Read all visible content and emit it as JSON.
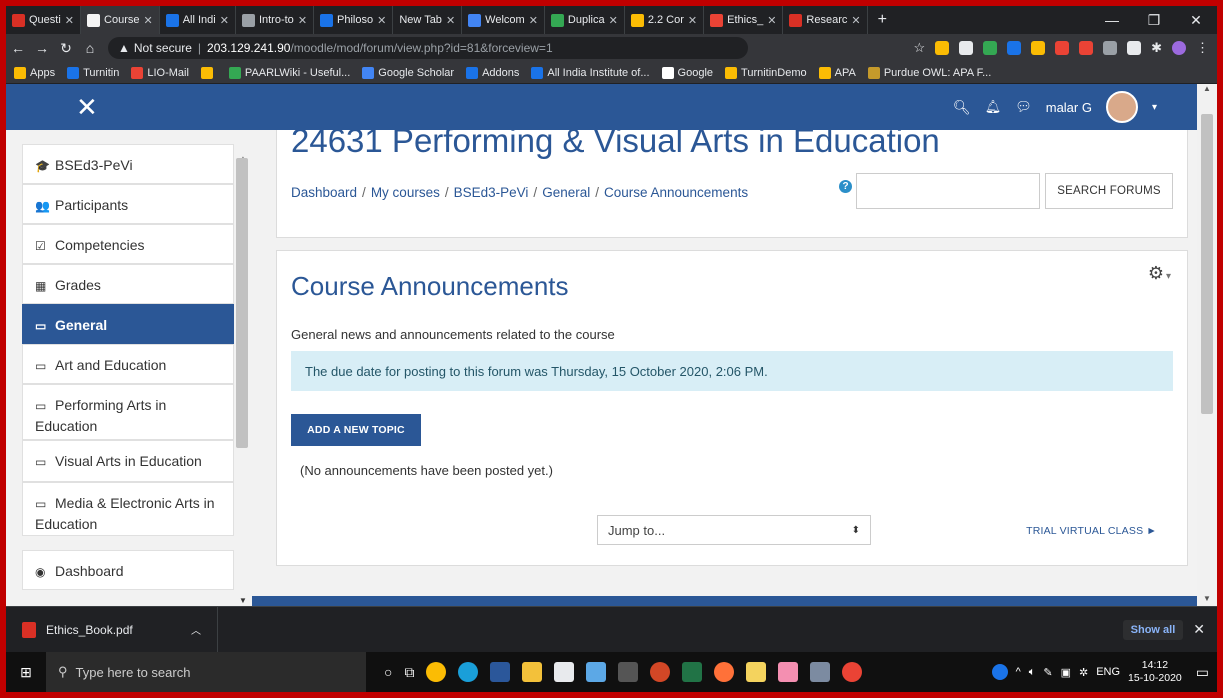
{
  "browser": {
    "tabs": [
      {
        "label": "Questi",
        "color": "#d93025",
        "active": false
      },
      {
        "label": "Course",
        "color": "#f4f4f4",
        "active": true
      },
      {
        "label": "All Indi",
        "color": "#1a73e8",
        "active": false
      },
      {
        "label": "Intro-to",
        "color": "#9aa0a6",
        "active": false
      },
      {
        "label": "Philoso",
        "color": "#1a73e8",
        "active": false
      },
      {
        "label": "New Tab",
        "color": "",
        "active": false
      },
      {
        "label": "Welcom",
        "color": "#4285f4",
        "active": false
      },
      {
        "label": "Duplica",
        "color": "#34a853",
        "active": false
      },
      {
        "label": "2.2 Cor",
        "color": "#fbbc04",
        "active": false
      },
      {
        "label": "Ethics_",
        "color": "#ea4335",
        "active": false
      },
      {
        "label": "Researc",
        "color": "#d93025",
        "active": false
      }
    ],
    "url_warning": "Not secure",
    "url_host": "203.129.241.90",
    "url_path": "/moodle/mod/forum/view.php?id=81&forceview=1",
    "bookmarks": [
      {
        "label": "Apps",
        "color": "#fbbc04"
      },
      {
        "label": "Turnitin",
        "color": "#1a73e8"
      },
      {
        "label": "LIO-Mail",
        "color": "#ea4335"
      },
      {
        "label": "",
        "color": "#fbbc04"
      },
      {
        "label": "PAARLWiki - Useful...",
        "color": "#34a853"
      },
      {
        "label": "Google Scholar",
        "color": "#4285f4"
      },
      {
        "label": "Addons",
        "color": "#1a73e8"
      },
      {
        "label": "All India Institute of...",
        "color": "#1a73e8"
      },
      {
        "label": "Google",
        "color": "#ffffff"
      },
      {
        "label": "TurnitinDemo",
        "color": "#fbbc04"
      },
      {
        "label": "APA",
        "color": "#fbbc04"
      },
      {
        "label": "Purdue OWL: APA F...",
        "color": "#c59a2b"
      }
    ]
  },
  "navbar": {
    "user_name": "malar G",
    "brand_color": "#2b5796"
  },
  "drawer": {
    "items": [
      {
        "label": "BSEd3-PeVi",
        "icon": "graduation-cap-icon",
        "glyph": "🎓",
        "active": false
      },
      {
        "label": "Participants",
        "icon": "users-icon",
        "glyph": "👥",
        "active": false
      },
      {
        "label": "Competencies",
        "icon": "checkbox-icon",
        "glyph": "☑",
        "active": false
      },
      {
        "label": "Grades",
        "icon": "table-icon",
        "glyph": "▦",
        "active": false
      },
      {
        "label": "General",
        "icon": "folder-icon",
        "glyph": "▭",
        "active": true
      },
      {
        "label": "Art and Education",
        "icon": "folder-icon",
        "glyph": "▭",
        "active": false
      },
      {
        "label": "Performing Arts in Education",
        "icon": "folder-icon",
        "glyph": "▭",
        "active": false
      },
      {
        "label": "Visual Arts in Education",
        "icon": "folder-icon",
        "glyph": "▭",
        "active": false
      },
      {
        "label": "Media & Electronic Arts in Education",
        "icon": "folder-icon",
        "glyph": "▭",
        "active": false
      },
      {
        "label": "Dashboard",
        "icon": "dashboard-icon",
        "glyph": "◉",
        "active": false
      }
    ]
  },
  "header": {
    "course_title": "24631 Performing & Visual Arts in Education",
    "breadcrumb": [
      "Dashboard",
      "My courses",
      "BSEd3-PeVi",
      "General",
      "Course Announcements"
    ],
    "search_placeholder": "",
    "search_button": "SEARCH FORUMS"
  },
  "forum": {
    "title": "Course Announcements",
    "description": "General news and announcements related to the course",
    "due_notice": "The due date for posting to this forum was Thursday, 15 October 2020, 2:06 PM.",
    "add_topic_label": "ADD A NEW TOPIC",
    "empty_text": "(No announcements have been posted yet.)",
    "jump_to": "Jump to...",
    "next_activity": "TRIAL VIRTUAL CLASS ►"
  },
  "downloads": {
    "file_name": "Ethics_Book.pdf",
    "show_all": "Show all"
  },
  "taskbar": {
    "search_placeholder": "Type here to search",
    "language": "ENG",
    "time": "14:12",
    "date": "15-10-2020"
  }
}
